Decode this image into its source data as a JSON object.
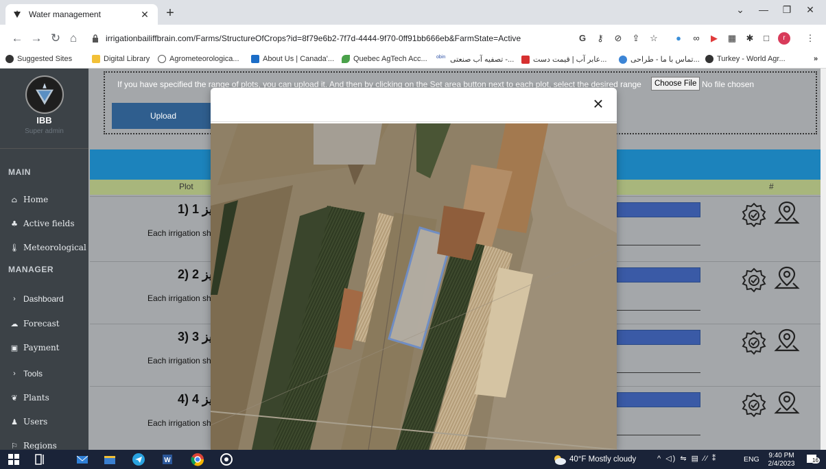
{
  "browser": {
    "tab_title": "Water management",
    "new_tab": "+",
    "url": "irrigationbailiffbrain.com/Farms/StructureOfCrops?id=8f79e6b2-7f7d-4444-9f70-0ff91bb666eb&FarmState=Active",
    "bookmarks": [
      "Suggested Sites",
      "Digital Library",
      "Agrometeorologica...",
      "About Us | Canada'...",
      "Quebec AgTech Acc...",
      "obin",
      "تصفیه آب صنعتی -...",
      "عابر آب | قیمت دست...",
      "تماس با ما - طراحی...",
      "Turkey - World Agr..."
    ]
  },
  "sidebar": {
    "brand": "IBB",
    "role": "Super admin",
    "section_main": "MAIN",
    "section_manager": "MANAGER",
    "items": [
      {
        "label": "Home",
        "icon": "home-icon"
      },
      {
        "label": "Active fields",
        "icon": "fields-icon"
      },
      {
        "label": "Meteorological",
        "icon": "thermometer-icon"
      },
      {
        "label": "Dashboard",
        "icon": "chevron-right-icon"
      },
      {
        "label": "Forecast",
        "icon": "forecast-icon"
      },
      {
        "label": "Payment",
        "icon": "payment-icon"
      },
      {
        "label": "Tools",
        "icon": "chevron-right-icon"
      },
      {
        "label": "Plants",
        "icon": "leaf-icon"
      },
      {
        "label": "Users",
        "icon": "users-icon"
      },
      {
        "label": "Regions",
        "icon": "flag-icon"
      }
    ]
  },
  "upload": {
    "text": "If you have specified the range of plots, you can upload it. And then by clicking on the Set area button next to each plot, select the desired range",
    "choose_file": "Choose File",
    "no_file": "No file chosen",
    "button": "Upload"
  },
  "table": {
    "col_plot": "Plot",
    "col_actions": "#",
    "rows": [
      {
        "title": "1) 1 یز",
        "sub": "Each irrigation sh"
      },
      {
        "title": "2) 2 یز",
        "sub": "Each irrigation sh"
      },
      {
        "title": "3) 3 یز",
        "sub": "Each irrigation sh"
      },
      {
        "title": "4) 4 یز",
        "sub": "Each irrigation sh"
      }
    ]
  },
  "modal": {
    "close": "×"
  },
  "taskbar": {
    "weather": "40°F  Mostly cloudy",
    "lang": "ENG",
    "time": "9:40 PM",
    "date": "2/4/2023",
    "notifications": "16"
  }
}
